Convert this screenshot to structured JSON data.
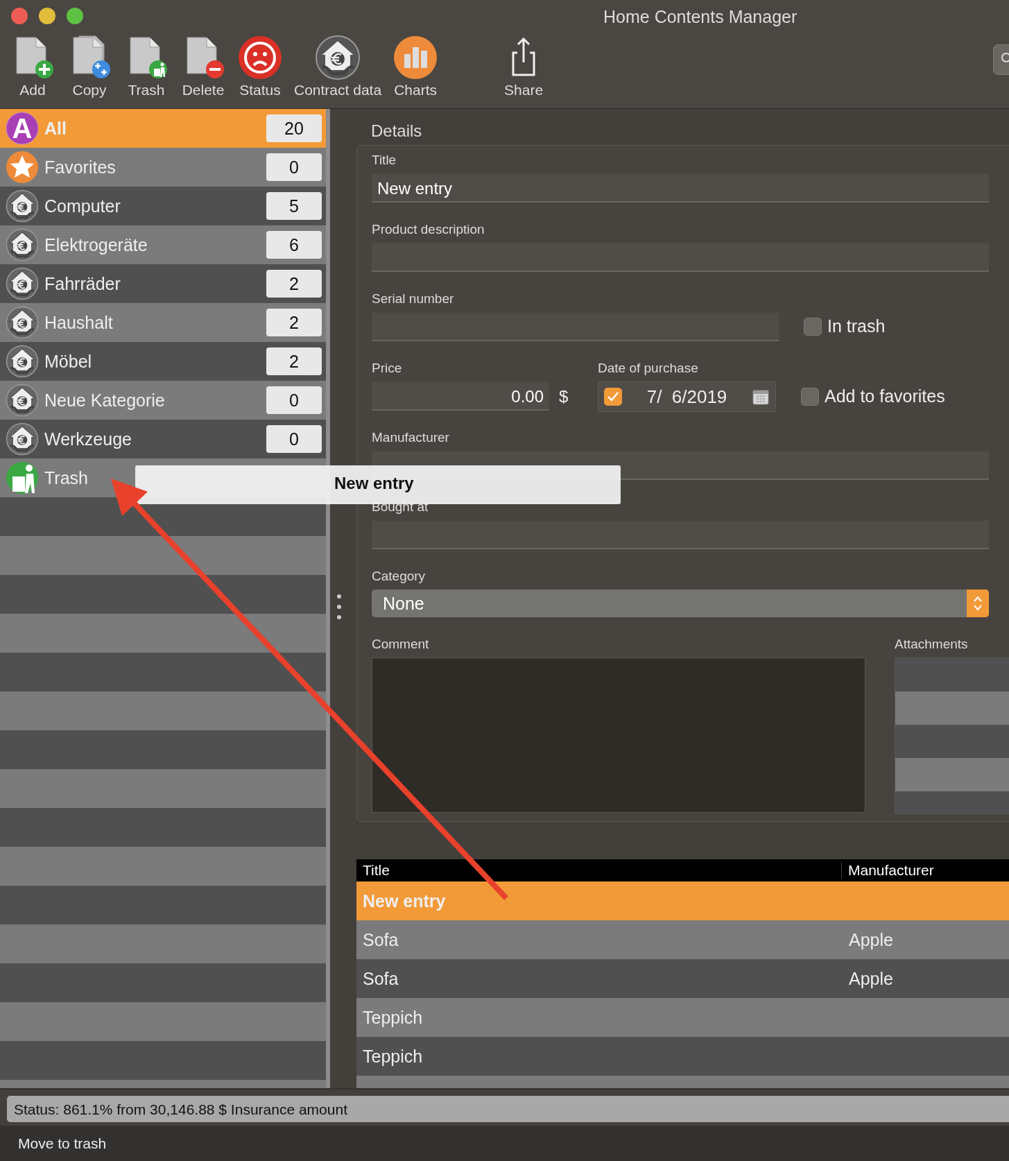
{
  "window": {
    "title": "Home Contents Manager"
  },
  "toolbar": [
    {
      "label": "Add",
      "kind": "add"
    },
    {
      "label": "Copy",
      "kind": "copy"
    },
    {
      "label": "Trash",
      "kind": "trash"
    },
    {
      "label": "Delete",
      "kind": "delete"
    },
    {
      "label": "Status",
      "kind": "status"
    },
    {
      "label": "Contract data",
      "kind": "contract"
    },
    {
      "label": "Charts",
      "kind": "charts"
    },
    {
      "label": "Share",
      "kind": "share"
    }
  ],
  "sidebar": {
    "items": [
      {
        "label": "All",
        "count": "20",
        "selected": true,
        "kind": "all",
        "icon_text": "A"
      },
      {
        "label": "Favorites",
        "count": "0",
        "selected": false,
        "kind": "favorites"
      },
      {
        "label": "Computer",
        "count": "5",
        "selected": false,
        "kind": "category"
      },
      {
        "label": "Elektrogeräte",
        "count": "6",
        "selected": false,
        "kind": "category"
      },
      {
        "label": "Fahrräder",
        "count": "2",
        "selected": false,
        "kind": "category"
      },
      {
        "label": "Haushalt",
        "count": "2",
        "selected": false,
        "kind": "category"
      },
      {
        "label": "Möbel",
        "count": "2",
        "selected": false,
        "kind": "category"
      },
      {
        "label": "Neue Kategorie",
        "count": "0",
        "selected": false,
        "kind": "category"
      },
      {
        "label": "Werkzeuge",
        "count": "0",
        "selected": false,
        "kind": "category"
      },
      {
        "label": "Trash",
        "selected": false,
        "kind": "trash"
      }
    ]
  },
  "drag_image": {
    "label": "New entry"
  },
  "details": {
    "heading": "Details",
    "title": {
      "label": "Title",
      "value": "New entry"
    },
    "product_description": {
      "label": "Product description"
    },
    "serial_number": {
      "label": "Serial number"
    },
    "in_trash": {
      "label": "In trash",
      "checked": false
    },
    "price": {
      "label": "Price",
      "value": "0.00",
      "currency": "$"
    },
    "date_of_purchase": {
      "label": "Date of purchase",
      "checked": true,
      "value": "7/  6/2019"
    },
    "add_to_favorites": {
      "label": "Add to favorites",
      "checked": false
    },
    "manufacturer": {
      "label": "Manufacturer"
    },
    "bought_at": {
      "label": "Bought at"
    },
    "category": {
      "label": "Category",
      "value": "None"
    },
    "comment": {
      "label": "Comment"
    },
    "attachments": {
      "label": "Attachments"
    }
  },
  "table": {
    "columns": [
      "Title",
      "Manufacturer"
    ],
    "rows": [
      {
        "title": "New entry",
        "selected": true
      },
      {
        "title": "Sofa",
        "manufacturer": "Apple",
        "selected": false
      },
      {
        "title": "Sofa",
        "manufacturer": "Apple",
        "selected": false
      },
      {
        "title": "Teppich",
        "selected": false
      },
      {
        "title": "Teppich",
        "selected": false
      }
    ]
  },
  "status_bar": {
    "text": "Status: 861.1% from 30,146.88 $ Insurance amount"
  },
  "footer": {
    "text": "Move to trash"
  }
}
